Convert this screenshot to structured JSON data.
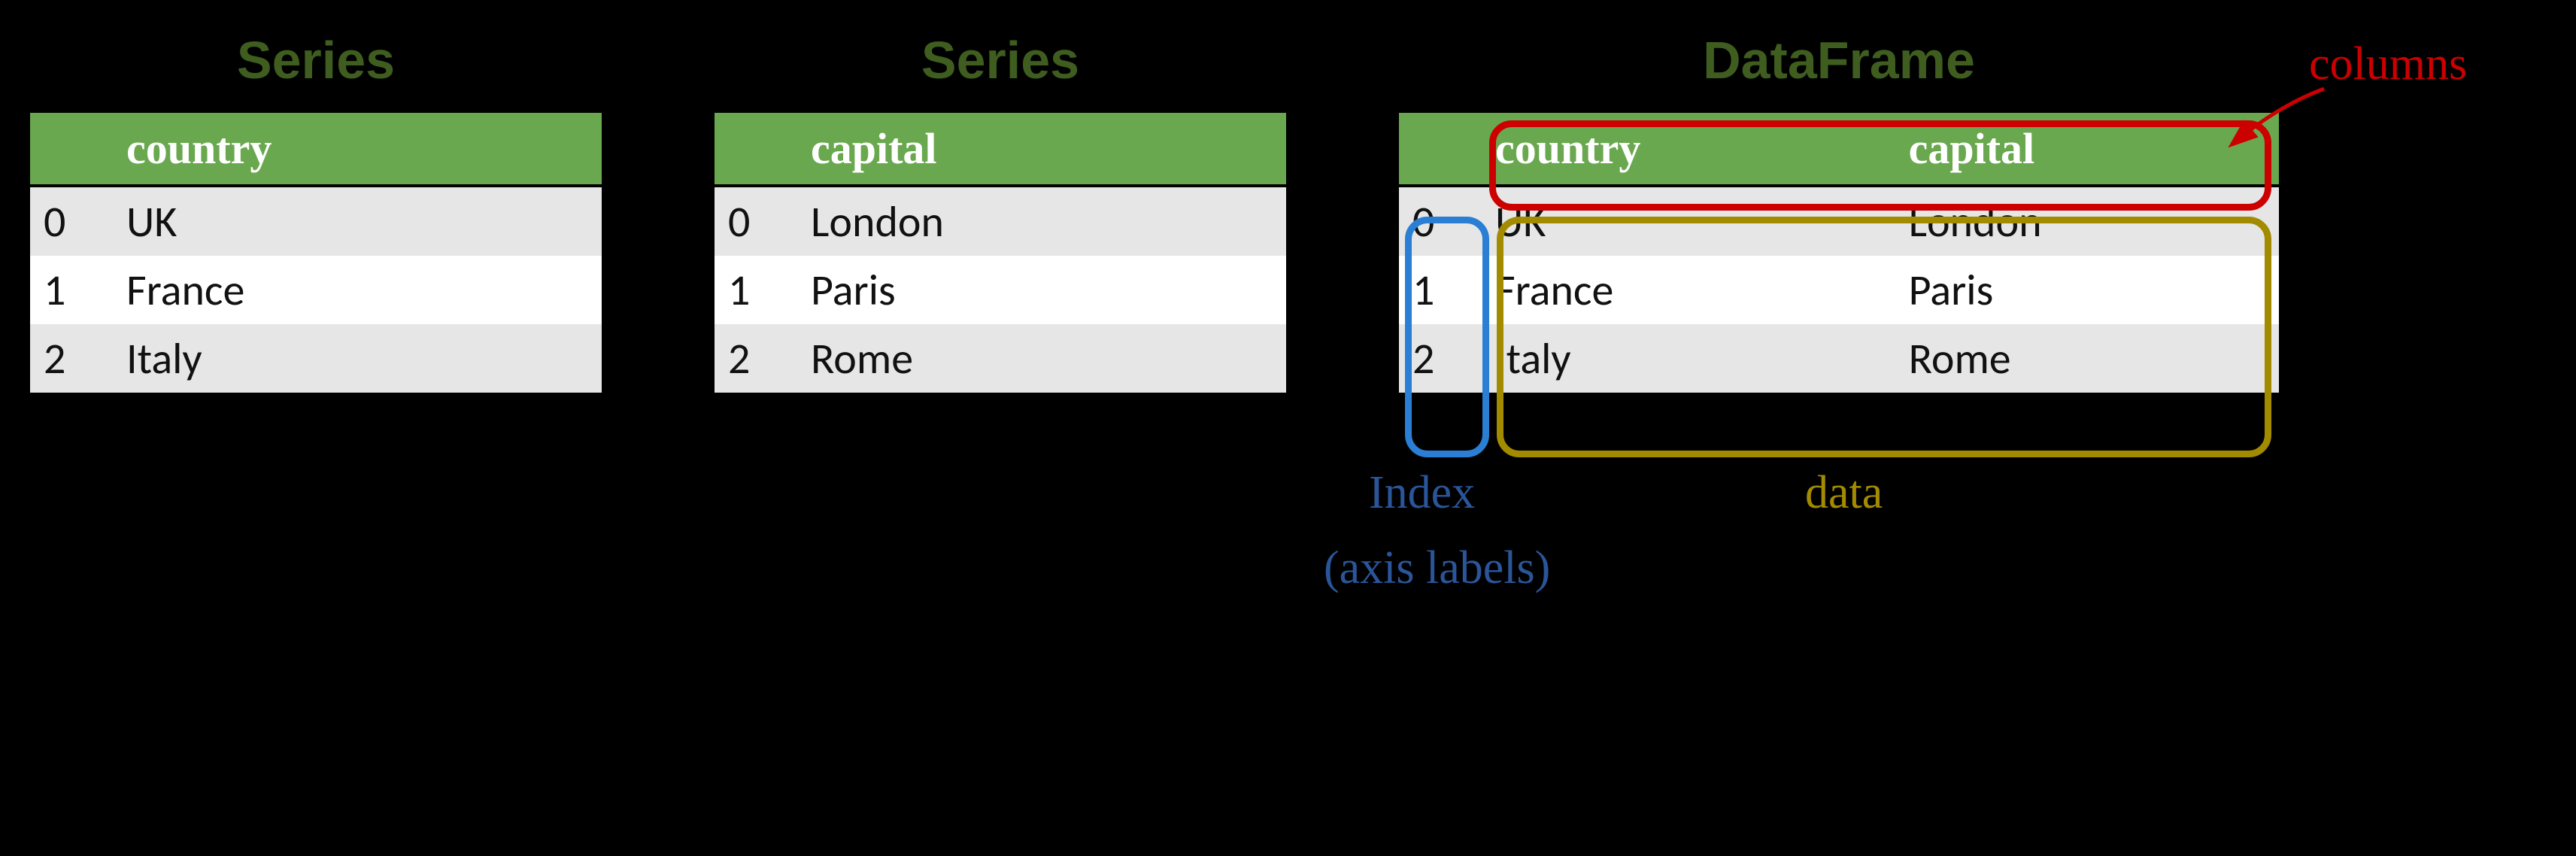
{
  "series1": {
    "title": "Series",
    "column": "country",
    "rows": [
      {
        "idx": "0",
        "val": "UK"
      },
      {
        "idx": "1",
        "val": "France"
      },
      {
        "idx": "2",
        "val": "Italy"
      }
    ]
  },
  "series2": {
    "title": "Series",
    "column": "capital",
    "rows": [
      {
        "idx": "0",
        "val": "London"
      },
      {
        "idx": "1",
        "val": "Paris"
      },
      {
        "idx": "2",
        "val": "Rome"
      }
    ]
  },
  "dataframe": {
    "title": "DataFrame",
    "columns": [
      "country",
      "capital"
    ],
    "rows": [
      {
        "idx": "0",
        "vals": [
          "UK",
          "London"
        ]
      },
      {
        "idx": "1",
        "vals": [
          "France",
          "Paris"
        ]
      },
      {
        "idx": "2",
        "vals": [
          "Italy",
          "Rome"
        ]
      }
    ]
  },
  "annotations": {
    "columns": "columns",
    "index_line1": "Index",
    "index_line2": "(axis labels)",
    "data": "data"
  },
  "colors": {
    "header_bg": "#6aa84f",
    "title_color": "#3e5d1f",
    "columns_ann": "#cc0000",
    "index_ann_border": "#2a7fd4",
    "index_ann_text": "#2a5599",
    "data_ann": "#a38b00"
  }
}
